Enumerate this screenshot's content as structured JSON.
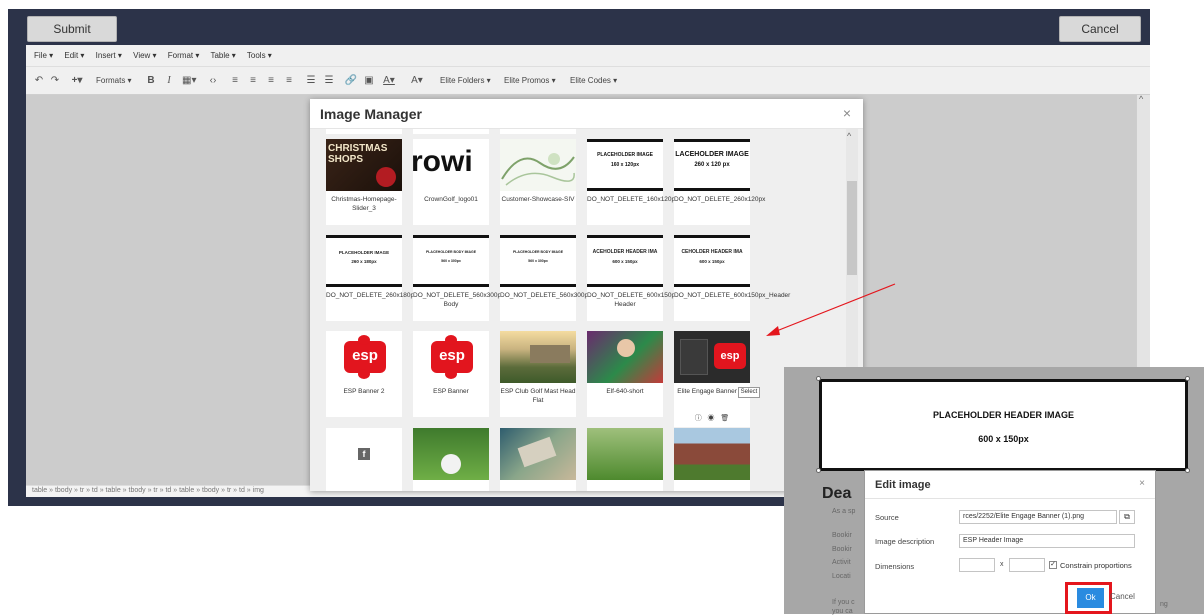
{
  "top": {
    "submit_label": "Submit",
    "cancel_label": "Cancel"
  },
  "menubar": [
    "File ▾",
    "Edit ▾",
    "Insert ▾",
    "View ▾",
    "Format ▾",
    "Table ▾",
    "Tools ▾"
  ],
  "toolbar": {
    "formats": "Formats ▾",
    "elite_folders": "Elite Folders ▾",
    "elite_promos": "Elite Promos ▾",
    "elite_codes": "Elite Codes ▾"
  },
  "statusbar": "table » tbody » tr » td » table » tbody » tr » td » table » tbody » tr » td » img",
  "image_manager": {
    "title": "Image Manager",
    "close": "×",
    "row1": [
      "Christmas-Homepage-Slider_3",
      "CrownGolf_logo01",
      "Customer-Showcase-SIV",
      "DO_NOT_DELETE_160x120px",
      "DO_NOT_DELETE_260x120px"
    ],
    "row2": [
      "DO_NOT_DELETE_260x180px",
      "DO_NOT_DELETE_560x300px Body",
      "DO_NOT_DELETE_560x300px_Body",
      "DO_NOT_DELETE_600x150px Header",
      "DO_NOT_DELETE_600x150px_Header"
    ],
    "row3": [
      "ESP Banner 2",
      "ESP Banner",
      "ESP Club Golf Mast Head Flat",
      "Elf-640-short",
      "Elite Engage Banner (1)"
    ],
    "thumb_texts": {
      "xmas": "CHRISTMAS SHOPS",
      "crown": "rowi",
      "ph1_line1": "PLACEHOLDER IMAGE",
      "ph1_line2": "160 x 120px",
      "ph2_line1": "LACEHOLDER IMAGE",
      "ph2_line2": "260 x 120 px",
      "ph3_line1": "PLACEHOLDER IMAGE",
      "ph3_line2": "260 x 180px",
      "ph4_line1": "PLACEHOLDER BODY IMAGE",
      "ph4_line2": "560 x 300px",
      "ph5_line1": "PLACEHOLDER BODY IMAGE",
      "ph5_line2": "560 x 300px",
      "ph6_line1": "ACEHOLDER HEADER IMA",
      "ph6_line2": "600 x 150px",
      "ph7_line1": "CEHOLDER HEADER IMA",
      "ph7_line2": "600 x 150px",
      "esp": "esp"
    },
    "select_tip": "Select",
    "facebook": "f"
  },
  "edit_preview": {
    "line1": "PLACEHOLDER HEADER IMAGE",
    "line2": "600 x 150px",
    "heading": "Dea"
  },
  "bg_fragments": [
    "As a sp",
    "Bookir",
    "Bookir",
    "Activit",
    "Locati",
    "If you c",
    "you ca",
    "ng"
  ],
  "edit_image": {
    "title": "Edit image",
    "close": "×",
    "source_label": "Source",
    "source_value": "rces/2252/Elite Engage Banner (1).png",
    "desc_label": "Image description",
    "desc_value": "ESP Header Image",
    "dims_label": "Dimensions",
    "width_value": "",
    "height_value": "",
    "x_sep": "x",
    "constrain_label": "Constrain proportions",
    "ok_label": "Ok",
    "cancel_label": "Cancel"
  },
  "colors": {
    "app_bg": "#2c3349",
    "accent_blue": "#2a8be0",
    "highlight_red": "#e4161d",
    "esp_red": "#e2151e"
  }
}
